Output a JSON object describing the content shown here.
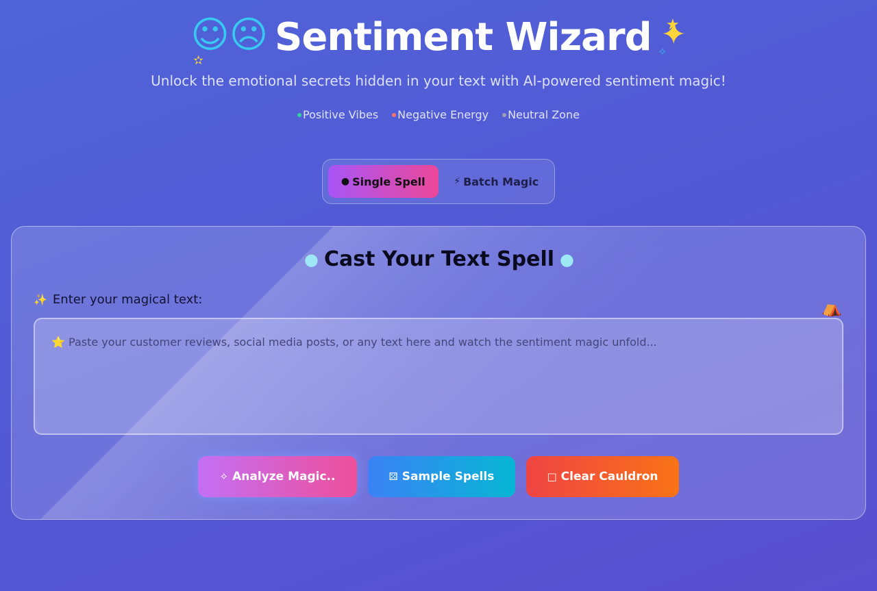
{
  "header": {
    "title": "Sentiment Wizard",
    "subtitle": "Unlock the emotional secrets hidden in your text with AI-powered sentiment magic!",
    "legend": [
      {
        "label": "Positive Vibes",
        "color": "#34d399"
      },
      {
        "label": "Negative Energy",
        "color": "#f87171"
      },
      {
        "label": "Neutral Zone",
        "color": "#9ca3af"
      }
    ]
  },
  "mode_toggle": {
    "single_label": "Single Spell",
    "batch_label": "Batch Magic",
    "active": "single"
  },
  "card": {
    "title": "Cast Your Text Spell",
    "field_label": "Enter your magical text:",
    "textarea_placeholder": "⭐ Paste your customer reviews, social media posts, or any text here and watch the sentiment magic unfold...",
    "buttons": {
      "analyze": "Analyze Magic..",
      "sample": "Sample Spells",
      "clear": "Clear Cauldron"
    }
  },
  "colors": {
    "accent_gradient_start": "#a855f7",
    "accent_gradient_end": "#ec4899",
    "sample_gradient_start": "#3b82f6",
    "sample_gradient_end": "#06b6d4",
    "clear_gradient_start": "#ef4444",
    "clear_gradient_end": "#f97316"
  }
}
